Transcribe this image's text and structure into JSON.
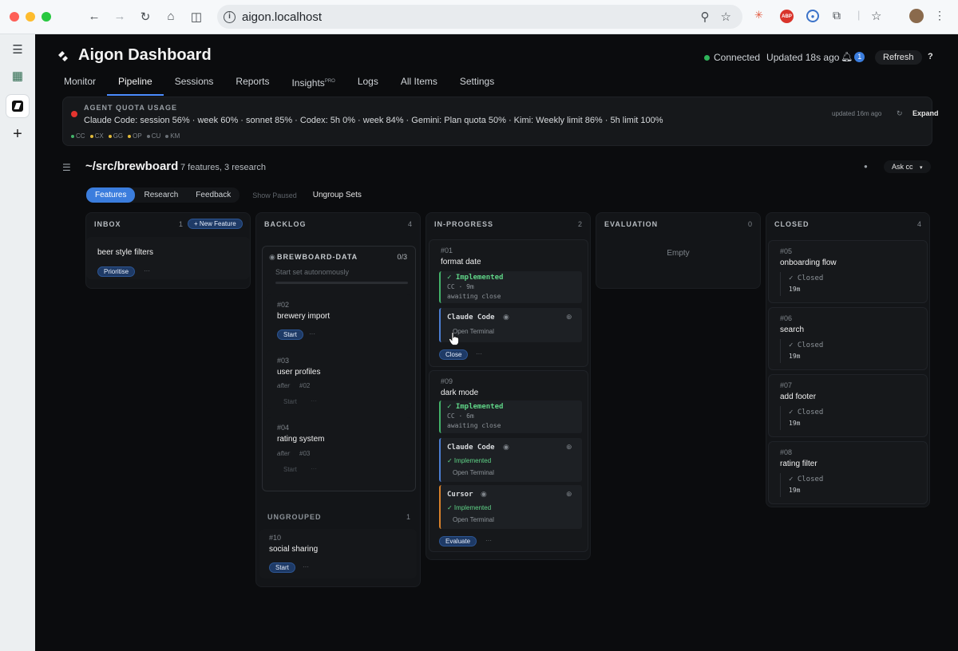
{
  "browser": {
    "url": "aigon.localhost",
    "tab_colors": {
      "close": "#fe5f57",
      "minimize": "#febc2e",
      "maximize": "#28c840"
    }
  },
  "app": {
    "title": "Aigon Dashboard",
    "status": "Connected",
    "updated": "Updated 18s ago",
    "notification_count": "1",
    "refresh_label": "Refresh",
    "help_label": "?"
  },
  "tabs": {
    "monitor": "Monitor",
    "pipeline": "Pipeline",
    "sessions": "Sessions",
    "reports": "Reports",
    "insights": "Insights",
    "insights_badge": "PRO",
    "logs": "Logs",
    "all_items": "All Items",
    "settings": "Settings"
  },
  "quota": {
    "heading": "AGENT QUOTA USAGE",
    "summary": "Claude Code: session 56% · week 60% · sonnet 85% · Codex: 5h 0% · week 84% · Gemini: Plan quota 50% · Kimi: Weekly limit 86% · 5h limit 100%",
    "legend": [
      {
        "label": "CC",
        "color": "#43b36a"
      },
      {
        "label": "CX",
        "color": "#e0b93a"
      },
      {
        "label": "GG",
        "color": "#e0b93a"
      },
      {
        "label": "OP",
        "color": "#e0b93a"
      },
      {
        "label": "CU",
        "color": "#6a7076"
      },
      {
        "label": "KM",
        "color": "#6a7076"
      }
    ],
    "updated": "updated 16m ago",
    "expand_label": "Expand"
  },
  "repo": {
    "path": "~/src/brewboard",
    "meta": "7 features, 3 research",
    "ask_label": "Ask cc"
  },
  "subtabs": {
    "features": "Features",
    "research": "Research",
    "feedback": "Feedback",
    "show_paused": "Show Paused",
    "ungroup": "Ungroup Sets"
  },
  "columns": {
    "inbox": {
      "name": "INBOX",
      "count": "1",
      "new_label": "+ New Feature",
      "cards": [
        {
          "title": "beer style filters",
          "action": "Prioritise"
        }
      ]
    },
    "backlog": {
      "name": "BACKLOG",
      "count": "4",
      "set": {
        "name": "BREWBOARD-DATA",
        "progress": "0/3",
        "hint": "Start set autonomously"
      },
      "cards": [
        {
          "num": "#02",
          "title": "brewery import",
          "action": "Start"
        },
        {
          "num": "#03",
          "title": "user profiles",
          "after": "after",
          "dep": "#02",
          "action": "Start"
        },
        {
          "num": "#04",
          "title": "rating system",
          "after": "after",
          "dep": "#03",
          "action": "Start"
        }
      ],
      "ungrouped": {
        "name": "UNGROUPED",
        "count": "1",
        "card": {
          "num": "#10",
          "title": "social sharing",
          "action": "Start"
        }
      }
    },
    "inprogress": {
      "name": "IN-PROGRESS",
      "count": "2",
      "card1": {
        "num": "#01",
        "title": "format date",
        "impl_title": "✓ Implemented",
        "impl_agent": "CC · 9m",
        "impl_status": "awaiting close",
        "agent": "Claude Code",
        "agent_action": "Open Terminal",
        "action": "Close"
      },
      "card2": {
        "num": "#09",
        "title": "dark mode",
        "impl_title": "✓ Implemented",
        "impl_agent": "CC · 6m",
        "impl_status": "awaiting close",
        "agent1": "Claude Code",
        "agent1_status": "✓ Implemented",
        "agent1_action": "Open Terminal",
        "agent2": "Cursor",
        "agent2_status": "✓ Implemented",
        "agent2_action": "Open Terminal",
        "action": "Evaluate"
      }
    },
    "evaluation": {
      "name": "EVALUATION",
      "count": "0",
      "empty": "Empty"
    },
    "closed": {
      "name": "CLOSED",
      "count": "4",
      "cards": [
        {
          "num": "#05",
          "title": "onboarding flow",
          "status": "✓ Closed",
          "age": "19m"
        },
        {
          "num": "#06",
          "title": "search",
          "status": "✓ Closed",
          "age": "19m"
        },
        {
          "num": "#07",
          "title": "add footer",
          "status": "✓ Closed",
          "age": "19m"
        },
        {
          "num": "#08",
          "title": "rating filter",
          "status": "✓ Closed",
          "age": "19m"
        }
      ]
    }
  },
  "more_label": "···"
}
